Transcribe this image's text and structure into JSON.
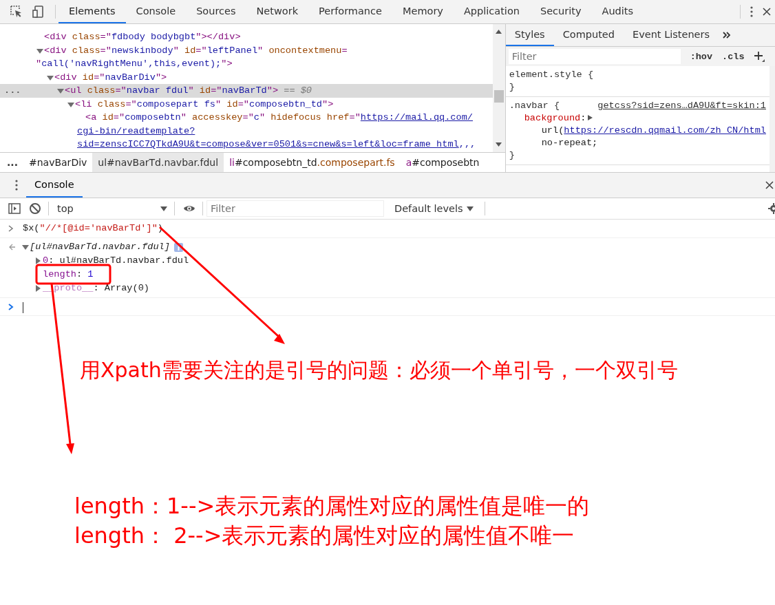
{
  "toolbar": {
    "tabs": [
      {
        "label": "Elements",
        "selected": true
      },
      {
        "label": "Console",
        "selected": false
      },
      {
        "label": "Sources",
        "selected": false
      },
      {
        "label": "Network",
        "selected": false
      },
      {
        "label": "Performance",
        "selected": false
      },
      {
        "label": "Memory",
        "selected": false
      },
      {
        "label": "Application",
        "selected": false
      },
      {
        "label": "Security",
        "selected": false
      },
      {
        "label": "Audits",
        "selected": false
      }
    ]
  },
  "dom_panel": {
    "row_menu": "...",
    "tree": [
      {
        "selected": false,
        "lines": [
          [
            {
              "kind": "tag",
              "text": "<div "
            },
            {
              "kind": "attr",
              "text": "class"
            },
            {
              "kind": "tag",
              "text": "=\""
            },
            {
              "kind": "value",
              "text": "fdbody bodybgbt"
            },
            {
              "kind": "tag",
              "text": "\"></div>"
            }
          ]
        ]
      },
      {
        "expanded": true,
        "selected": false,
        "lines": [
          [
            {
              "kind": "tag",
              "text": "<div "
            },
            {
              "kind": "attr",
              "text": "class"
            },
            {
              "kind": "tag",
              "text": "=\""
            },
            {
              "kind": "value",
              "text": "newskinbody"
            },
            {
              "kind": "tag",
              "text": "\" "
            },
            {
              "kind": "attr",
              "text": "id"
            },
            {
              "kind": "tag",
              "text": "=\""
            },
            {
              "kind": "value",
              "text": "leftPanel"
            },
            {
              "kind": "tag",
              "text": "\" "
            },
            {
              "kind": "attr",
              "text": "oncontextmenu"
            },
            {
              "kind": "tag",
              "text": "="
            }
          ],
          [
            {
              "kind": "tag",
              "text": "\""
            },
            {
              "kind": "value",
              "text": "call('navRightMenu',this,event);"
            },
            {
              "kind": "tag",
              "text": "\">"
            }
          ]
        ],
        "children": [
          {
            "expanded": true,
            "selected": false,
            "lines": [
              [
                {
                  "kind": "tag",
                  "text": "<div "
                },
                {
                  "kind": "attr",
                  "text": "id"
                },
                {
                  "kind": "tag",
                  "text": "=\""
                },
                {
                  "kind": "value",
                  "text": "navBarDiv"
                },
                {
                  "kind": "tag",
                  "text": "\">"
                }
              ]
            ],
            "children": [
              {
                "expanded": true,
                "selected": true,
                "lines": [
                  [
                    {
                      "kind": "tag",
                      "text": "<ul "
                    },
                    {
                      "kind": "attr",
                      "text": "class"
                    },
                    {
                      "kind": "tag",
                      "text": "=\""
                    },
                    {
                      "kind": "value",
                      "text": "navbar fdul"
                    },
                    {
                      "kind": "tag",
                      "text": "\" "
                    },
                    {
                      "kind": "attr",
                      "text": "id"
                    },
                    {
                      "kind": "tag",
                      "text": "=\""
                    },
                    {
                      "kind": "value",
                      "text": "navBarTd"
                    },
                    {
                      "kind": "tag",
                      "text": "\">"
                    },
                    {
                      "kind": "dim",
                      "text": " == $0"
                    }
                  ]
                ],
                "children": [
                  {
                    "expanded": true,
                    "selected": false,
                    "lines": [
                      [
                        {
                          "kind": "tag",
                          "text": "<li "
                        },
                        {
                          "kind": "attr",
                          "text": "class"
                        },
                        {
                          "kind": "tag",
                          "text": "=\""
                        },
                        {
                          "kind": "value",
                          "text": "composepart fs"
                        },
                        {
                          "kind": "tag",
                          "text": "\" "
                        },
                        {
                          "kind": "attr",
                          "text": "id"
                        },
                        {
                          "kind": "tag",
                          "text": "=\""
                        },
                        {
                          "kind": "value",
                          "text": "composebtn_td"
                        },
                        {
                          "kind": "tag",
                          "text": "\">"
                        }
                      ]
                    ],
                    "children": [
                      {
                        "selected": false,
                        "lines": [
                          [
                            {
                              "kind": "tag",
                              "text": "<a "
                            },
                            {
                              "kind": "attr",
                              "text": "id"
                            },
                            {
                              "kind": "tag",
                              "text": "=\""
                            },
                            {
                              "kind": "value",
                              "text": "composebtn"
                            },
                            {
                              "kind": "tag",
                              "text": "\" "
                            },
                            {
                              "kind": "attr",
                              "text": "accesskey"
                            },
                            {
                              "kind": "tag",
                              "text": "=\""
                            },
                            {
                              "kind": "value",
                              "text": "c"
                            },
                            {
                              "kind": "tag",
                              "text": "\" "
                            },
                            {
                              "kind": "attr",
                              "text": "hidefocus href"
                            },
                            {
                              "kind": "tag",
                              "text": "=\""
                            },
                            {
                              "kind": "link",
                              "text": "https://mail.qq.com/"
                            }
                          ],
                          [
                            {
                              "kind": "link",
                              "text": "cgi-bin/readtemplate?"
                            }
                          ],
                          [
                            {
                              "kind": "link",
                              "text": "sid=zenscICC7QTkdA9U&t=compose&ver=0501&s=cnew&s=left&loc=frame_html"
                            },
                            {
                              "kind": "value",
                              "text": ",,,"
                            }
                          ]
                        ]
                      }
                    ]
                  }
                ]
              }
            ]
          }
        ]
      }
    ]
  },
  "breadcrumbs": {
    "more": "...",
    "items": [
      {
        "selected": false,
        "parts": [
          {
            "kind": "id",
            "text": "#navBarDiv"
          }
        ]
      },
      {
        "selected": true,
        "parts": [
          {
            "kind": "tag",
            "text": "ul"
          },
          {
            "kind": "id",
            "text": "#navBarTd"
          },
          {
            "kind": "cls",
            "text": ".navbar.fdul"
          }
        ]
      },
      {
        "selected": false,
        "parts": [
          {
            "kind": "tag",
            "text": "li"
          },
          {
            "kind": "id",
            "text": "#composebtn_td"
          },
          {
            "kind": "cls",
            "text": ".composepart.fs"
          }
        ]
      },
      {
        "selected": false,
        "parts": [
          {
            "kind": "tag",
            "text": "a"
          },
          {
            "kind": "id",
            "text": "#composebtn"
          }
        ]
      }
    ]
  },
  "styles_panel": {
    "tabs": [
      {
        "label": "Styles",
        "selected": true
      },
      {
        "label": "Computed",
        "selected": false
      },
      {
        "label": "Event Listeners",
        "selected": false
      }
    ],
    "filter_placeholder": "Filter",
    "hov": ":hov",
    "cls": ".cls",
    "rules": [
      {
        "selector": "element.style",
        "open": "{",
        "close": "}"
      },
      {
        "selector": ".navbar",
        "open": "{",
        "source": "getcss?sid=zens…dA9U&ft=skin:1",
        "declarations": [
          {
            "property": "background",
            "colon": ":",
            "expanded": false,
            "values": [
              [
                {
                  "kind": "plain",
                  "text": "url("
                },
                {
                  "kind": "link",
                  "text": "https://rescdn.qqmail.com/zh_CN/html"
                }
              ],
              [
                {
                  "kind": "plain",
                  "text": "no-repeat;"
                }
              ]
            ]
          }
        ],
        "close": "}"
      }
    ]
  },
  "drawer": {
    "tabs": [
      {
        "label": "Console",
        "selected": true
      }
    ],
    "context": "top",
    "filter_placeholder": "Filter",
    "levels": "Default levels",
    "entries": [
      {
        "kind": "input",
        "segments": [
          {
            "kind": "plain",
            "text": "$x("
          },
          {
            "kind": "string",
            "text": "\"//*[@id='navBarTd']\""
          },
          {
            "kind": "plain",
            "text": ")"
          }
        ]
      },
      {
        "kind": "result",
        "expanded": true,
        "segments": [
          {
            "kind": "italic",
            "text": "[ul#navBarTd.navbar.fdul]"
          }
        ],
        "children": [
          {
            "expanded": false,
            "segments": [
              {
                "kind": "key",
                "text": "0"
              },
              {
                "kind": "plain",
                "text": ": "
              },
              {
                "kind": "node",
                "text": "ul#navBarTd.navbar.fdul"
              }
            ]
          },
          {
            "segments": [
              {
                "kind": "key",
                "text": "length"
              },
              {
                "kind": "plain",
                "text": ": "
              },
              {
                "kind": "number",
                "text": "1"
              }
            ]
          },
          {
            "expanded": false,
            "segments": [
              {
                "kind": "keydim",
                "text": "__proto__"
              },
              {
                "kind": "plain",
                "text": ": Array(0)"
              }
            ]
          }
        ]
      },
      {
        "kind": "prompt"
      }
    ]
  },
  "annotations": {
    "notes": [
      "用Xpath需要关注的是引号的问题：必须一个单引号，一个双引号",
      "length：1-->表示元素的属性对应的属性值是唯一的",
      "length：  2-->表示元素的属性对应的属性值不唯一"
    ]
  }
}
